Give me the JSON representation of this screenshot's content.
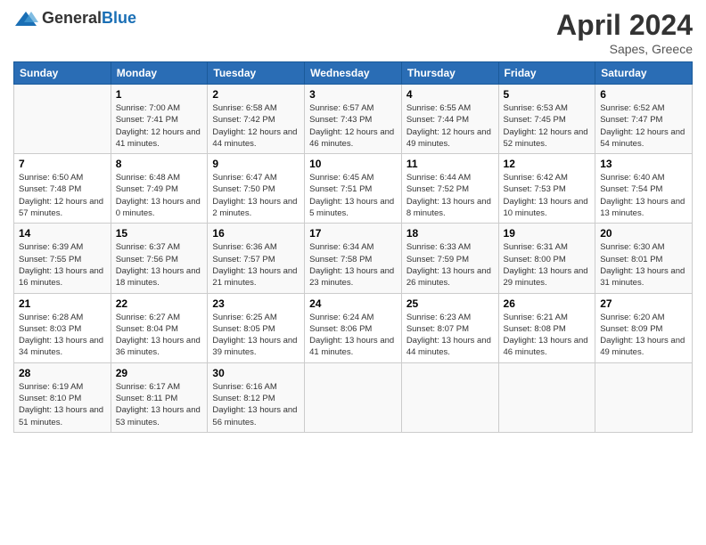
{
  "header": {
    "logo_general": "General",
    "logo_blue": "Blue",
    "month_title": "April 2024",
    "location": "Sapes, Greece"
  },
  "weekdays": [
    "Sunday",
    "Monday",
    "Tuesday",
    "Wednesday",
    "Thursday",
    "Friday",
    "Saturday"
  ],
  "weeks": [
    [
      {
        "day": "",
        "sunrise": "",
        "sunset": "",
        "daylight": ""
      },
      {
        "day": "1",
        "sunrise": "Sunrise: 7:00 AM",
        "sunset": "Sunset: 7:41 PM",
        "daylight": "Daylight: 12 hours and 41 minutes."
      },
      {
        "day": "2",
        "sunrise": "Sunrise: 6:58 AM",
        "sunset": "Sunset: 7:42 PM",
        "daylight": "Daylight: 12 hours and 44 minutes."
      },
      {
        "day": "3",
        "sunrise": "Sunrise: 6:57 AM",
        "sunset": "Sunset: 7:43 PM",
        "daylight": "Daylight: 12 hours and 46 minutes."
      },
      {
        "day": "4",
        "sunrise": "Sunrise: 6:55 AM",
        "sunset": "Sunset: 7:44 PM",
        "daylight": "Daylight: 12 hours and 49 minutes."
      },
      {
        "day": "5",
        "sunrise": "Sunrise: 6:53 AM",
        "sunset": "Sunset: 7:45 PM",
        "daylight": "Daylight: 12 hours and 52 minutes."
      },
      {
        "day": "6",
        "sunrise": "Sunrise: 6:52 AM",
        "sunset": "Sunset: 7:47 PM",
        "daylight": "Daylight: 12 hours and 54 minutes."
      }
    ],
    [
      {
        "day": "7",
        "sunrise": "Sunrise: 6:50 AM",
        "sunset": "Sunset: 7:48 PM",
        "daylight": "Daylight: 12 hours and 57 minutes."
      },
      {
        "day": "8",
        "sunrise": "Sunrise: 6:48 AM",
        "sunset": "Sunset: 7:49 PM",
        "daylight": "Daylight: 13 hours and 0 minutes."
      },
      {
        "day": "9",
        "sunrise": "Sunrise: 6:47 AM",
        "sunset": "Sunset: 7:50 PM",
        "daylight": "Daylight: 13 hours and 2 minutes."
      },
      {
        "day": "10",
        "sunrise": "Sunrise: 6:45 AM",
        "sunset": "Sunset: 7:51 PM",
        "daylight": "Daylight: 13 hours and 5 minutes."
      },
      {
        "day": "11",
        "sunrise": "Sunrise: 6:44 AM",
        "sunset": "Sunset: 7:52 PM",
        "daylight": "Daylight: 13 hours and 8 minutes."
      },
      {
        "day": "12",
        "sunrise": "Sunrise: 6:42 AM",
        "sunset": "Sunset: 7:53 PM",
        "daylight": "Daylight: 13 hours and 10 minutes."
      },
      {
        "day": "13",
        "sunrise": "Sunrise: 6:40 AM",
        "sunset": "Sunset: 7:54 PM",
        "daylight": "Daylight: 13 hours and 13 minutes."
      }
    ],
    [
      {
        "day": "14",
        "sunrise": "Sunrise: 6:39 AM",
        "sunset": "Sunset: 7:55 PM",
        "daylight": "Daylight: 13 hours and 16 minutes."
      },
      {
        "day": "15",
        "sunrise": "Sunrise: 6:37 AM",
        "sunset": "Sunset: 7:56 PM",
        "daylight": "Daylight: 13 hours and 18 minutes."
      },
      {
        "day": "16",
        "sunrise": "Sunrise: 6:36 AM",
        "sunset": "Sunset: 7:57 PM",
        "daylight": "Daylight: 13 hours and 21 minutes."
      },
      {
        "day": "17",
        "sunrise": "Sunrise: 6:34 AM",
        "sunset": "Sunset: 7:58 PM",
        "daylight": "Daylight: 13 hours and 23 minutes."
      },
      {
        "day": "18",
        "sunrise": "Sunrise: 6:33 AM",
        "sunset": "Sunset: 7:59 PM",
        "daylight": "Daylight: 13 hours and 26 minutes."
      },
      {
        "day": "19",
        "sunrise": "Sunrise: 6:31 AM",
        "sunset": "Sunset: 8:00 PM",
        "daylight": "Daylight: 13 hours and 29 minutes."
      },
      {
        "day": "20",
        "sunrise": "Sunrise: 6:30 AM",
        "sunset": "Sunset: 8:01 PM",
        "daylight": "Daylight: 13 hours and 31 minutes."
      }
    ],
    [
      {
        "day": "21",
        "sunrise": "Sunrise: 6:28 AM",
        "sunset": "Sunset: 8:03 PM",
        "daylight": "Daylight: 13 hours and 34 minutes."
      },
      {
        "day": "22",
        "sunrise": "Sunrise: 6:27 AM",
        "sunset": "Sunset: 8:04 PM",
        "daylight": "Daylight: 13 hours and 36 minutes."
      },
      {
        "day": "23",
        "sunrise": "Sunrise: 6:25 AM",
        "sunset": "Sunset: 8:05 PM",
        "daylight": "Daylight: 13 hours and 39 minutes."
      },
      {
        "day": "24",
        "sunrise": "Sunrise: 6:24 AM",
        "sunset": "Sunset: 8:06 PM",
        "daylight": "Daylight: 13 hours and 41 minutes."
      },
      {
        "day": "25",
        "sunrise": "Sunrise: 6:23 AM",
        "sunset": "Sunset: 8:07 PM",
        "daylight": "Daylight: 13 hours and 44 minutes."
      },
      {
        "day": "26",
        "sunrise": "Sunrise: 6:21 AM",
        "sunset": "Sunset: 8:08 PM",
        "daylight": "Daylight: 13 hours and 46 minutes."
      },
      {
        "day": "27",
        "sunrise": "Sunrise: 6:20 AM",
        "sunset": "Sunset: 8:09 PM",
        "daylight": "Daylight: 13 hours and 49 minutes."
      }
    ],
    [
      {
        "day": "28",
        "sunrise": "Sunrise: 6:19 AM",
        "sunset": "Sunset: 8:10 PM",
        "daylight": "Daylight: 13 hours and 51 minutes."
      },
      {
        "day": "29",
        "sunrise": "Sunrise: 6:17 AM",
        "sunset": "Sunset: 8:11 PM",
        "daylight": "Daylight: 13 hours and 53 minutes."
      },
      {
        "day": "30",
        "sunrise": "Sunrise: 6:16 AM",
        "sunset": "Sunset: 8:12 PM",
        "daylight": "Daylight: 13 hours and 56 minutes."
      },
      {
        "day": "",
        "sunrise": "",
        "sunset": "",
        "daylight": ""
      },
      {
        "day": "",
        "sunrise": "",
        "sunset": "",
        "daylight": ""
      },
      {
        "day": "",
        "sunrise": "",
        "sunset": "",
        "daylight": ""
      },
      {
        "day": "",
        "sunrise": "",
        "sunset": "",
        "daylight": ""
      }
    ]
  ]
}
